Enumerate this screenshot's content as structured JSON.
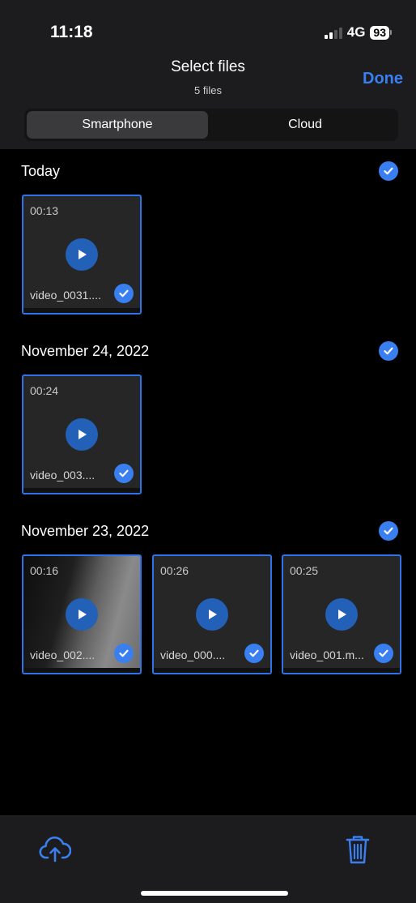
{
  "status_bar": {
    "time": "11:18",
    "network": "4G",
    "battery": "93"
  },
  "nav": {
    "title": "Select files",
    "subtitle": "5 files",
    "done_label": "Done"
  },
  "tabs": [
    {
      "label": "Smartphone",
      "selected": true
    },
    {
      "label": "Cloud",
      "selected": false
    }
  ],
  "sections": [
    {
      "title": "Today",
      "selected": true,
      "items": [
        {
          "duration": "00:13",
          "name": "video_0031....",
          "selected": true
        }
      ]
    },
    {
      "title": "November 24, 2022",
      "selected": true,
      "items": [
        {
          "duration": "00:24",
          "name": "video_003....",
          "selected": true
        }
      ]
    },
    {
      "title": "November 23, 2022",
      "selected": true,
      "items": [
        {
          "duration": "00:16",
          "name": "video_002....",
          "selected": true
        },
        {
          "duration": "00:26",
          "name": "video_000....",
          "selected": true
        },
        {
          "duration": "00:25",
          "name": "video_001.m...",
          "selected": true
        }
      ]
    }
  ],
  "toolbar": {
    "upload_icon": "cloud-upload-icon",
    "delete_icon": "trash-icon"
  },
  "colors": {
    "accent": "#3a7ff0",
    "background": "#000000",
    "bar": "#1c1c1e"
  }
}
